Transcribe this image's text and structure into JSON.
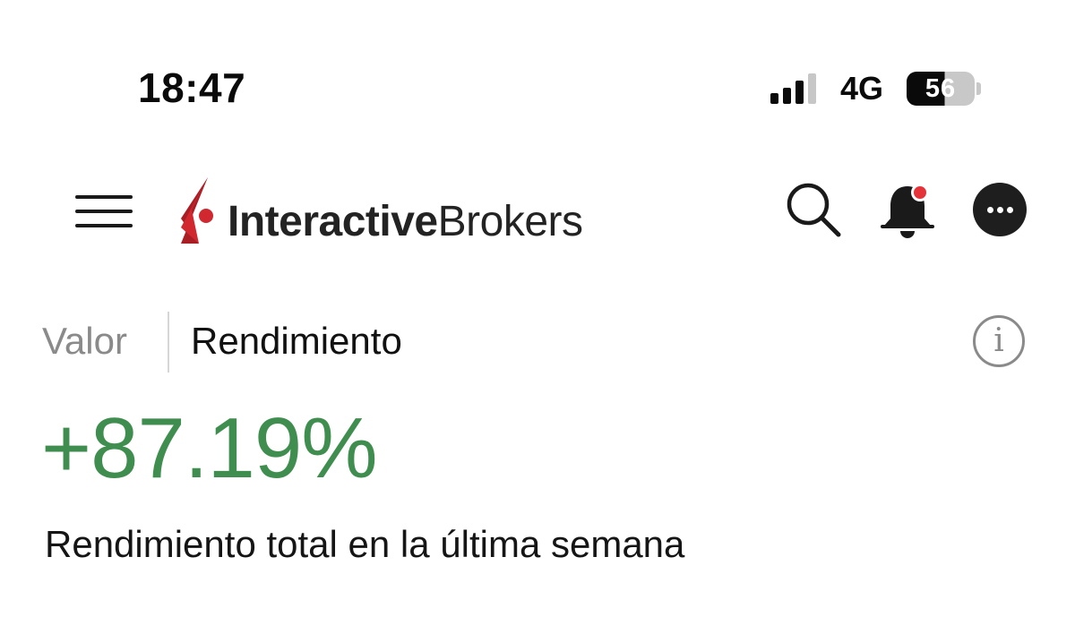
{
  "status_bar": {
    "time": "18:47",
    "network": "4G",
    "battery_level": "56",
    "signal_bars_active": 3,
    "signal_bars_total": 4
  },
  "header": {
    "logo_bold": "Interactive",
    "logo_light": "Brokers",
    "brand_color": "#d1272f",
    "icons": [
      "menu-icon",
      "search-icon",
      "bell-icon",
      "more-icon"
    ],
    "notification_dot_color": "#e5333a"
  },
  "tabs": {
    "valor": "Valor",
    "rendimiento": "Rendimiento",
    "active": "Rendimiento"
  },
  "info_icon": "i",
  "performance": {
    "value": "+87.19%",
    "caption": "Rendimiento total en la última semana",
    "value_color": "#3f8e4f"
  }
}
